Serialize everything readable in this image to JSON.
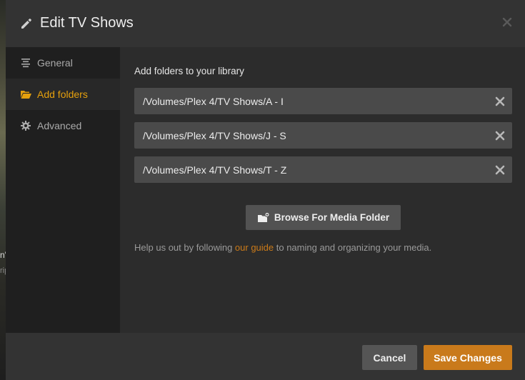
{
  "background": {
    "peek_text_1": "n'",
    "peek_text_2": "rip"
  },
  "header": {
    "title": "Edit TV Shows"
  },
  "sidebar": {
    "items": [
      {
        "label": "General",
        "icon": "list-icon",
        "active": false
      },
      {
        "label": "Add folders",
        "icon": "folder-open-icon",
        "active": true
      },
      {
        "label": "Advanced",
        "icon": "gear-icon",
        "active": false
      }
    ]
  },
  "main": {
    "section_label": "Add folders to your library",
    "folders": [
      "/Volumes/Plex 4/TV Shows/A - I",
      "/Volumes/Plex 4/TV Shows/J - S",
      "/Volumes/Plex 4/TV Shows/T - Z"
    ],
    "browse_label": "Browse For Media Folder",
    "help": {
      "before": "Help us out by following ",
      "link": "our guide",
      "after": " to naming and organizing your media."
    }
  },
  "footer": {
    "cancel_label": "Cancel",
    "save_label": "Save Changes"
  },
  "colors": {
    "accent": "#e5a00d",
    "save_button": "#c97a1b",
    "link": "#cc7b19"
  }
}
